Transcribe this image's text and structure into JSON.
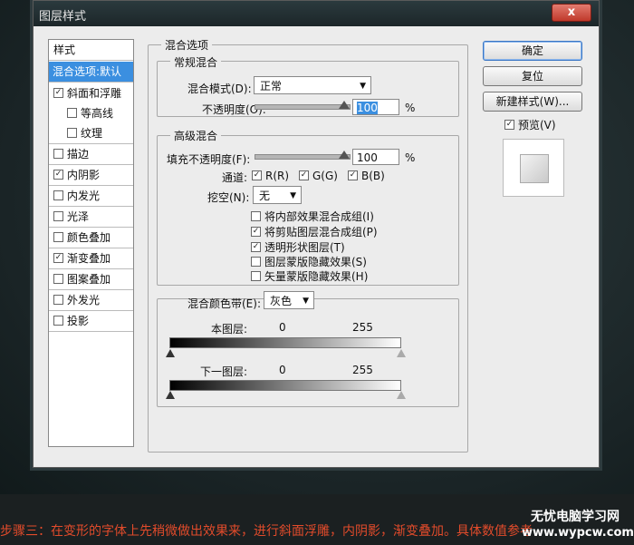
{
  "dialog": {
    "title": "图层样式",
    "close_label": "x"
  },
  "styles": {
    "header": "样式",
    "selected": "混合选项:默认",
    "items": [
      {
        "label": "斜面和浮雕",
        "checked": true
      },
      {
        "label": "等高线",
        "checked": false
      },
      {
        "label": "纹理",
        "checked": false
      },
      {
        "label": "描边",
        "checked": false
      },
      {
        "label": "内阴影",
        "checked": true
      },
      {
        "label": "内发光",
        "checked": false
      },
      {
        "label": "光泽",
        "checked": false
      },
      {
        "label": "颜色叠加",
        "checked": false
      },
      {
        "label": "渐变叠加",
        "checked": true
      },
      {
        "label": "图案叠加",
        "checked": false
      },
      {
        "label": "外发光",
        "checked": false
      },
      {
        "label": "投影",
        "checked": false
      }
    ]
  },
  "blend": {
    "section_title": "混合选项",
    "general": {
      "title": "常规混合",
      "mode_label": "混合模式(D):",
      "mode_value": "正常",
      "opacity_label": "不透明度(O):",
      "opacity_value": "100",
      "pct": "%"
    },
    "advanced": {
      "title": "高级混合",
      "fill_label": "填充不透明度(F):",
      "fill_value": "100",
      "pct": "%",
      "channels_label": "通道:",
      "channels": [
        {
          "label": "R(R)",
          "checked": true
        },
        {
          "label": "G(G)",
          "checked": true
        },
        {
          "label": "B(B)",
          "checked": true
        }
      ],
      "knockout_label": "挖空(N):",
      "knockout_value": "无",
      "options": [
        {
          "label": "将内部效果混合成组(I)",
          "checked": false
        },
        {
          "label": "将剪贴图层混合成组(P)",
          "checked": true
        },
        {
          "label": "透明形状图层(T)",
          "checked": true
        },
        {
          "label": "图层蒙版隐藏效果(S)",
          "checked": false
        },
        {
          "label": "矢量蒙版隐藏效果(H)",
          "checked": false
        }
      ]
    },
    "blend_if": {
      "label": "混合颜色带(E):",
      "value": "灰色",
      "this_layer": {
        "label": "本图层:",
        "min": "0",
        "max": "255"
      },
      "under_layer": {
        "label": "下一图层:",
        "min": "0",
        "max": "255"
      }
    }
  },
  "buttons": {
    "ok": "确定",
    "reset": "复位",
    "new_style": "新建样式(W)...",
    "preview": "预览(V)",
    "preview_checked": true
  },
  "caption": "步骤三：在变形的字体上先稍微做出效果来，进行斜面浮雕，内阴影，渐变叠加。具体数值参考",
  "watermark": {
    "top": "无忧电脑学习网",
    "bottom": "www.wypcw.com"
  }
}
